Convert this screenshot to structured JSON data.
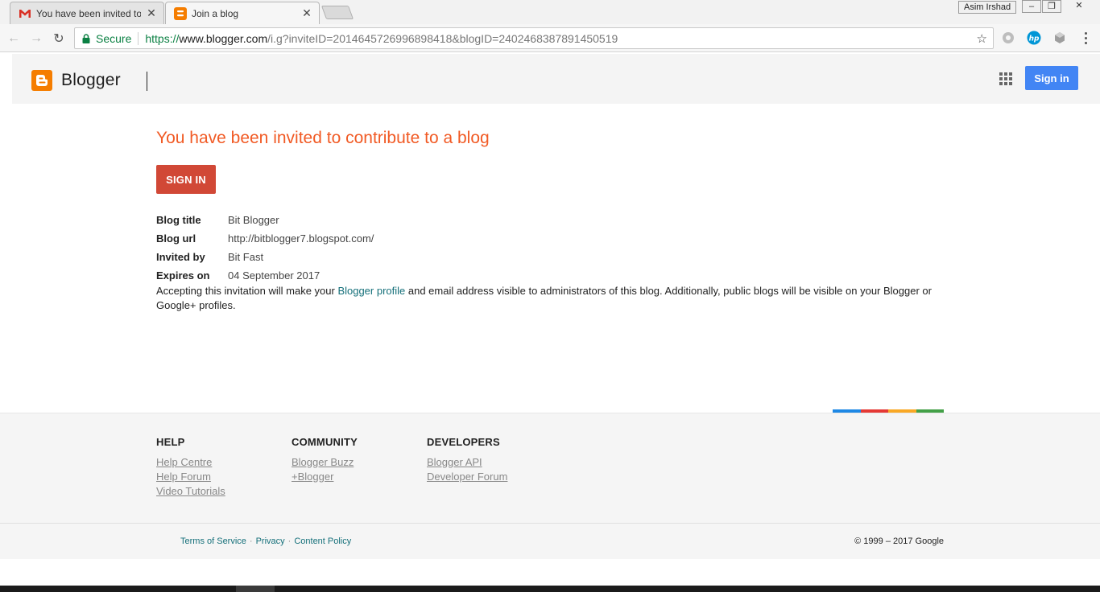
{
  "browser": {
    "tabs": [
      {
        "title": "You have been invited to",
        "favicon": "gmail-icon"
      },
      {
        "title": "Join a blog",
        "favicon": "blogger-icon"
      }
    ],
    "profile_name": "Asim Irshad",
    "security_label": "Secure",
    "url_scheme": "https://",
    "url_host": "www.blogger.com",
    "url_rest": "/i.g?inviteID=2014645726996898418&blogID=2402468387891450519"
  },
  "header": {
    "logo_text": "Blogger",
    "signin_label": "Sign in"
  },
  "invite": {
    "title": "You have been invited to contribute to a blog",
    "signin_cta": "SIGN IN",
    "details": [
      {
        "label": "Blog title",
        "value": "Bit Blogger"
      },
      {
        "label": "Blog url",
        "value": "http://bitblogger7.blogspot.com/"
      },
      {
        "label": "Invited by",
        "value": "Bit Fast"
      },
      {
        "label": "Expires on",
        "value": "04 September 2017"
      }
    ],
    "notice_before": "Accepting this invitation will make your ",
    "notice_link": "Blogger profile",
    "notice_after": " and email address visible to administrators of this blog. Additionally, public blogs will be visible on your Blogger or Google+ profiles."
  },
  "footer": {
    "columns": [
      {
        "heading": "HELP",
        "links": [
          "Help Centre",
          "Help Forum",
          "Video Tutorials"
        ]
      },
      {
        "heading": "COMMUNITY",
        "links": [
          "Blogger Buzz",
          "+Blogger"
        ]
      },
      {
        "heading": "DEVELOPERS",
        "links": [
          "Blogger API",
          "Developer Forum"
        ]
      }
    ],
    "legal_links": [
      "Terms of Service",
      "Privacy",
      "Content Policy"
    ],
    "separator": "·",
    "copyright": "© 1999 – 2017 Google",
    "brand_colors": [
      "#1e88e5",
      "#e53935",
      "#f9a825",
      "#43a047"
    ]
  },
  "colors": {
    "accent_orange": "#f15a24",
    "signin_red": "#d14836",
    "signin_blue": "#4285f4",
    "link_teal": "#15707a"
  }
}
